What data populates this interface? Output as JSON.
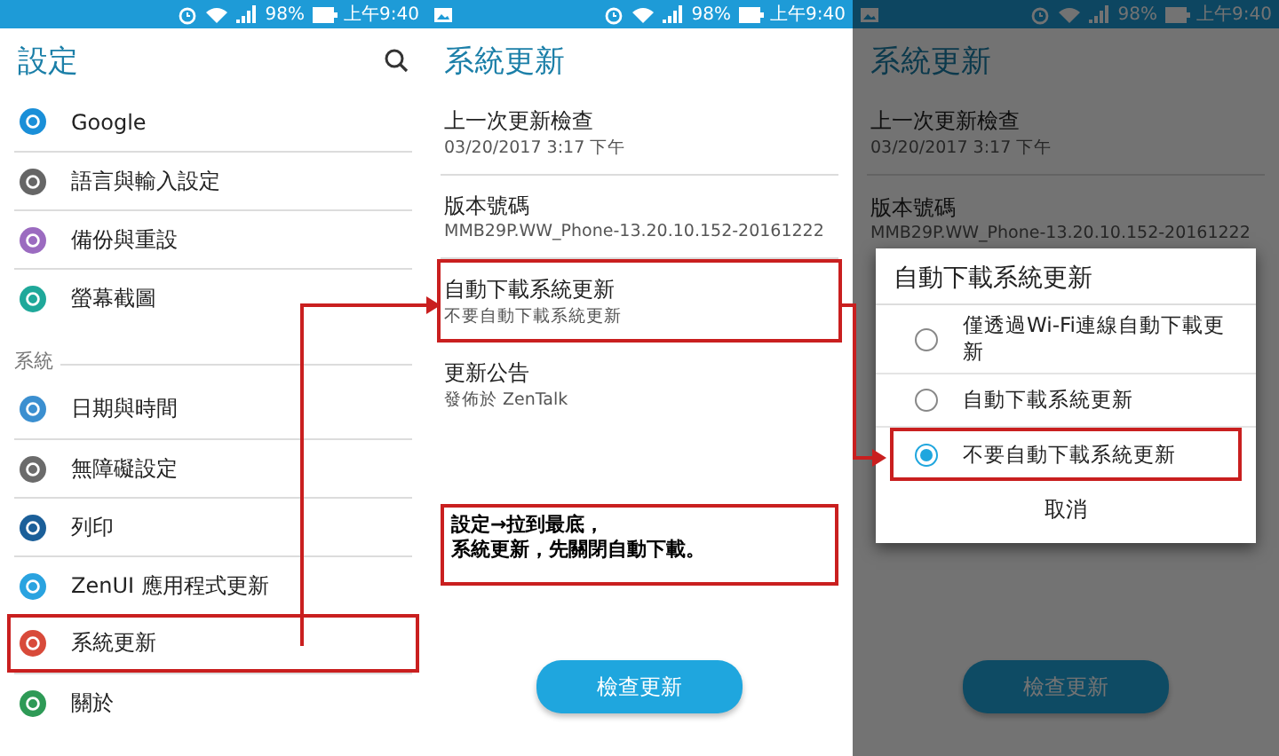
{
  "settings_screen": {
    "status_bar": {
      "notification": false,
      "battery": "98%",
      "time": "上午9:40"
    },
    "title": "設定",
    "items": [
      {
        "kind": "item",
        "label": "Google",
        "color": "#1a8fd8",
        "highlighted": false
      },
      {
        "kind": "item",
        "label": "語言與輸入設定",
        "color": "#666666",
        "highlighted": false
      },
      {
        "kind": "item",
        "label": "備份與重設",
        "color": "#9b6bc0",
        "highlighted": false
      },
      {
        "kind": "item",
        "label": "螢幕截圖",
        "color": "#1fa89a",
        "highlighted": false
      },
      {
        "kind": "section",
        "label": "系統"
      },
      {
        "kind": "item",
        "label": "日期與時間",
        "color": "#3b8fd0",
        "highlighted": false
      },
      {
        "kind": "item",
        "label": "無障礙設定",
        "color": "#6b6b6b",
        "highlighted": false
      },
      {
        "kind": "item",
        "label": "列印",
        "color": "#1b5f99",
        "highlighted": false
      },
      {
        "kind": "item",
        "label": "ZenUI 應用程式更新",
        "color": "#2aa3e0",
        "highlighted": false
      },
      {
        "kind": "item",
        "label": "系統更新",
        "color": "#d84a3a",
        "highlighted": true
      },
      {
        "kind": "item",
        "label": "關於",
        "color": "#2e9a56",
        "highlighted": false
      }
    ]
  },
  "update_screen": {
    "status_bar": {
      "notification": true,
      "battery": "98%",
      "time": "上午9:40"
    },
    "title": "系統更新",
    "entries": [
      {
        "title": "上一次更新檢查",
        "subtitle": "03/20/2017 3:17 下午",
        "highlighted": false
      },
      {
        "title": "版本號碼",
        "subtitle": "MMB29P.WW_Phone-13.20.10.152-20161222",
        "highlighted": false
      },
      {
        "title": "自動下載系統更新",
        "subtitle": "不要自動下載系統更新",
        "highlighted": true
      },
      {
        "title": "更新公告",
        "subtitle": "發佈於 ZenTalk",
        "highlighted": false
      }
    ],
    "note": [
      "設定→拉到最底，",
      "系統更新，先關閉自動下載。"
    ],
    "check_button": "檢查更新"
  },
  "dialog_screen": {
    "status_bar": {
      "notification": true,
      "battery": "98%",
      "time": "上午9:40"
    },
    "title": "系統更新",
    "entries": [
      {
        "title": "上一次更新檢查",
        "subtitle": "03/20/2017 3:17 下午"
      },
      {
        "title": "版本號碼",
        "subtitle": "MMB29P.WW_Phone-13.20.10.152-20161222"
      }
    ],
    "check_button": "檢查更新",
    "dialog": {
      "title": "自動下載系統更新",
      "options": [
        {
          "label": "僅透過Wi-Fi連線自動下載更新",
          "selected": false,
          "highlighted": false
        },
        {
          "label": "自動下載系統更新",
          "selected": false,
          "highlighted": false
        },
        {
          "label": "不要自動下載系統更新",
          "selected": true,
          "highlighted": true
        }
      ],
      "cancel": "取消"
    }
  }
}
